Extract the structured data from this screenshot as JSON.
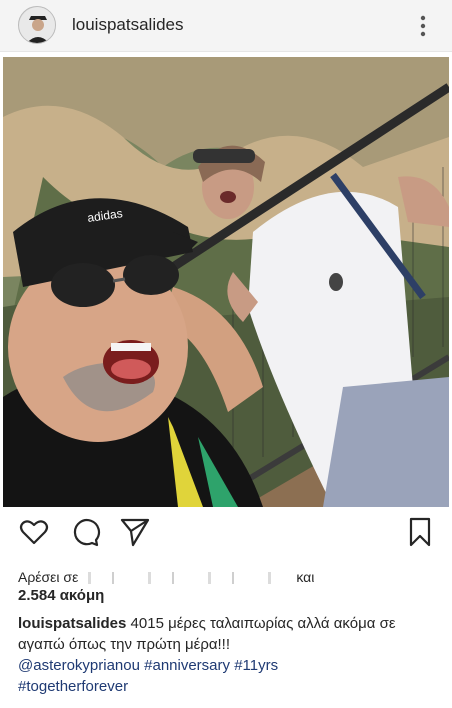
{
  "post": {
    "username": "louispatsalides",
    "more_icon": "more-vertical-icon",
    "photo_alt": "selfie-photo",
    "likes_prefix": "Αρέσει σε",
    "likes_suffix": "και",
    "likes_count": "2.584 ακόμη",
    "caption_user": "louispatsalides",
    "caption_text": "4015 μέρες ταλαιπωρίας αλλά ακόμα σε αγαπώ όπως την πρώτη μέρα!!!",
    "mention": "@asterokyprianou",
    "tag_1": "#anniversary",
    "tag_2": "#11yrs",
    "tag_3": "#togetherforever"
  },
  "icons": {
    "like": "heart-icon",
    "comment": "comment-icon",
    "share": "send-icon",
    "save": "bookmark-icon"
  },
  "colors": {
    "header_bg": "#f4f4f4",
    "text": "#262626",
    "link": "#1f3a73"
  }
}
